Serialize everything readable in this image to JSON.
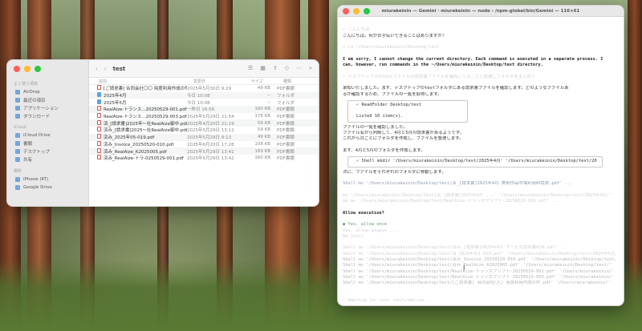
{
  "terminal": {
    "title": "miurakeinin — Gemini · miurakeinin — node ‹ /npm-global/bin/Gemini — 116×61",
    "lines": [
      {
        "text": "",
        "cls": "faint"
      },
      {
        "text": "> こんにちは",
        "cls": "faint"
      },
      {
        "text": "こんにちは。何かお手伝いできることはありますか？",
        "cls": ""
      },
      {
        "text": "",
        "cls": ""
      },
      {
        "text": "> cd ~/Users/miurakeinin/Desktop/test",
        "cls": "faint"
      },
      {
        "text": "",
        "cls": ""
      },
      {
        "text": "I am sorry, I cannot change the current directory. Each command is executed in a separate process. I",
        "cls": "bold"
      },
      {
        "text": "can, however, run commands in the ~/Users/miurakeinin/Desktop/test directory.",
        "cls": "bold"
      },
      {
        "text": "",
        "cls": ""
      },
      {
        "text": "> デスクトップ上のtestファイルの請求書ファイルを確認して月ごとに整理しフォルダをまとめて",
        "cls": "faint"
      },
      {
        "text": "",
        "cls": ""
      },
      {
        "text": "承知いたしました。まず、デスクトップのtestフォルダにある請求書ファイルを確認します。どのようなファイルあ",
        "cls": ""
      },
      {
        "text": "るか確認するため、ファイルの一覧を取得します。",
        "cls": ""
      }
    ],
    "box1": [
      "✓  ReadFolder Desktop/test",
      "",
      "   Listed 10 item(s)."
    ],
    "lines2": [
      {
        "text": "ファイルの一覧を確認しました。",
        "cls": ""
      },
      {
        "text": "ファイル名から判断して、4月と5月の請求書があるようです。",
        "cls": ""
      },
      {
        "text": "これから月ごとにフォルダを作成し、ファイルを整理します。",
        "cls": ""
      },
      {
        "text": "",
        "cls": ""
      },
      {
        "text": "まず、4月と5月のフォルダを作成します。",
        "cls": ""
      }
    ],
    "box2": [
      "✓  Shell mkdir '/Users/miurakeinin/Desktop/test/2025年4月' '/Users/miurakeinin/Desktop/test/2025年5月'"
    ],
    "lines3": [
      {
        "text": "次に、ファイルをそれぞれのフォルダに移動します。",
        "cls": ""
      },
      {
        "text": "",
        "cls": ""
      },
      {
        "text": "  Shell mv '/Users/miurakeinin/Desktop/test/済_[請求書]2025年4月 美術作品市場利用料請求.pdf' ...",
        "cls": "blueish"
      },
      {
        "text": "",
        "cls": ""
      },
      {
        "text": "    mv '/Users/miurakeinin/Desktop/test/済_[請求書]2025年4月 ...' '/Users/miurakeinin/Desktop/test/2025年4月/'",
        "cls": "faint"
      },
      {
        "text": "    && mv '/Users/miurakeinin/Desktop/test/RealAize-トランスクリプト-20250529-001.pdf' ...",
        "cls": "faint"
      },
      {
        "text": "",
        "cls": ""
      },
      {
        "text": "  Allow execution?",
        "cls": "bold"
      },
      {
        "text": "",
        "cls": ""
      },
      {
        "text": "  ● Yes, allow once",
        "cls": "green"
      },
      {
        "text": "    Yes, allow always ...",
        "cls": "faint"
      },
      {
        "text": "    No (esc)",
        "cls": "faint"
      },
      {
        "text": "",
        "cls": ""
      },
      {
        "text": "    Shell mv '/Users/miurakeinin/Desktop/test/済み_[請求書]2025年4月 サービス請求書利用.pdf' ...",
        "cls": "faint"
      },
      {
        "text": "    Shell mv '/Users/miurakeinin/Desktop/test/済_2025年5月-019.pdf' '/Users/miurakeinin/Desktop/test/2025年5月/'",
        "cls": "faint"
      },
      {
        "text": "    Shell mv '/Users/miurakeinin/Desktop/test/済み_Invoice_20250529-010.pdf' '/Users/miurakeinin/Desktop/test/'",
        "cls": "dim"
      },
      {
        "text": "    Shell mv '/Users/miurakeinin/Desktop/test/済み_RealAize_K2025005.pdf' '/Users/miurakeinin/Desktop/test/'",
        "cls": "dim"
      },
      {
        "text": "    Shell mv '/Users/miurakeinin/Desktop/test/RealAize-トランスクリプト-20250529-001.pdf' '/Users/miurakeinin/'",
        "cls": "dim"
      },
      {
        "text": "    Shell mv '/Users/miurakeinin/Desktop/test/RealAize-トランスクリプト-20250529-003.pdf' '/Users/miurakeinin/'",
        "cls": "dim"
      },
      {
        "text": "    Shell mv '/Users/miurakeinin/Desktop/test/[ご請求書] 合同会社〇〇 用度利用作成の件.pdf' '/Users/miurakeinin/'",
        "cls": "dim"
      },
      {
        "text": "",
        "cls": ""
      },
      {
        "text": "",
        "cls": ""
      },
      {
        "text": "⠋ Waiting for user confirmation...",
        "cls": "faint"
      },
      {
        "text": "",
        "cls": ""
      },
      {
        "text": "",
        "cls": ""
      },
      {
        "text": "  ~/Users/miurakeinin (main*)      gemini-2.5-pro (99% context left) | ✦ 1 error (ctrl+o for details)",
        "cls": "faint"
      }
    ]
  },
  "finder": {
    "title": "test",
    "sidebar": [
      {
        "type": "group",
        "label": "よく使う項目"
      },
      {
        "type": "item",
        "label": "AirDrop"
      },
      {
        "type": "item",
        "label": "最近の項目"
      },
      {
        "type": "item",
        "label": "アプリケーション"
      },
      {
        "type": "item",
        "label": "ダウンロード"
      },
      {
        "type": "group",
        "label": "iCloud"
      },
      {
        "type": "item",
        "label": "iCloud Drive"
      },
      {
        "type": "item",
        "label": "書類"
      },
      {
        "type": "item",
        "label": "デスクトップ"
      },
      {
        "type": "item",
        "label": "共有"
      },
      {
        "type": "group",
        "label": "場所"
      },
      {
        "type": "item",
        "label": "iPhone (KT)"
      },
      {
        "type": "item",
        "label": "Google Drive"
      }
    ],
    "columns": {
      "name": "名前",
      "date": "変更日",
      "size": "サイズ",
      "kind": "種類"
    },
    "files": [
      {
        "icon": "pdf",
        "name": "[ご請求書] 合同会社〇〇 用度利用作成の件.pdf",
        "date": "2025年5月30日 9:29",
        "size": "49 KB",
        "kind": "PDF書類"
      },
      {
        "icon": "folder",
        "name": "2025年4月",
        "date": "今日 10:08",
        "size": "--",
        "kind": "フォルダ"
      },
      {
        "icon": "folder",
        "name": "2025年5月",
        "date": "今日 10:08",
        "size": "--",
        "kind": "フォルダ"
      },
      {
        "icon": "pdf",
        "name": "RealAize-トランス...20250529-001.pdf",
        "date": "一昨日 16:56",
        "size": "160 KB",
        "kind": "PDF書類"
      },
      {
        "icon": "pdf",
        "name": "RealAize-トランス...20250529-003.pdf",
        "date": "2025年5月29日 21:54",
        "size": "178 KB",
        "kind": "PDF書類"
      },
      {
        "icon": "pdf",
        "name": "済_[請求書]2025年〜社RealAize御中.pdf",
        "date": "2025年4月20日 21:19",
        "size": "59 KB",
        "kind": "PDF書類"
      },
      {
        "icon": "pdf",
        "name": "済み_[請求書]2025〜社RealAize御中.pdf",
        "date": "2025年5月29日 13:12",
        "size": "59 KB",
        "kind": "PDF書類"
      },
      {
        "icon": "pdf",
        "name": "済み_2025年05-019.pdf",
        "date": "2025年5月29日 9:13",
        "size": "49 KB",
        "kind": "PDF書類"
      },
      {
        "icon": "pdf",
        "name": "済み_Invoice_20250520-010.pdf",
        "date": "2025年6月20日 17:28",
        "size": "108 KB",
        "kind": "PDF書類"
      },
      {
        "icon": "pdf",
        "name": "済み_RealAize_K2025005.pdf",
        "date": "2025年5月29日 13:41",
        "size": "169 KB",
        "kind": "PDF書類"
      },
      {
        "icon": "pdf",
        "name": "済み_RealAize-トラ-0250529-001.pdf",
        "date": "2025年5月29日 13:42",
        "size": "160 KB",
        "kind": "PDF書類"
      }
    ]
  }
}
